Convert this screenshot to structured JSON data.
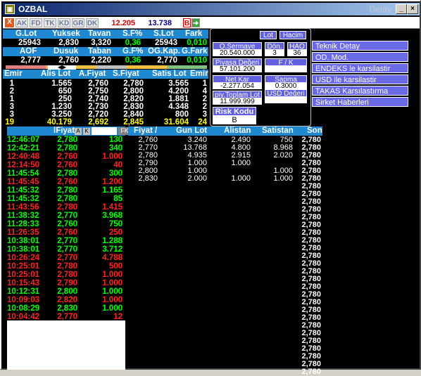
{
  "window": {
    "title": "OZBAL",
    "detail_label": "Detay"
  },
  "toolbar": {
    "close": "X",
    "tabs": [
      "AK",
      "FD",
      "TK",
      "KD",
      "GR",
      "DK"
    ],
    "value1": "12.205",
    "value2": "13.738",
    "b": "B"
  },
  "summary1": {
    "headers": [
      "G.Lot",
      "Yuksek",
      "Tavan",
      "S.F%",
      "S.Lot",
      "Fark"
    ],
    "values": [
      "25943",
      "2,830",
      "3,320",
      "0,36",
      "25943",
      "0,010"
    ]
  },
  "summary2": {
    "headers": [
      "AOF",
      "Dusuk",
      "Taban",
      "G.F%",
      "OG.Kap.",
      "G.Fark"
    ],
    "values": [
      "2,777",
      "2,760",
      "2,220",
      "0,36",
      "2,770",
      "0,010"
    ]
  },
  "book": {
    "headers": [
      "Emir",
      "Alis Lot",
      "A.Fiyat",
      "S.Fiyat",
      "Satis Lot",
      "Emir"
    ],
    "rows": [
      [
        "1",
        "1.565",
        "2,760",
        "2,780",
        "3.565",
        "1"
      ],
      [
        "2",
        "650",
        "2,750",
        "2,800",
        "4.200",
        "4"
      ],
      [
        "1",
        "250",
        "2,740",
        "2,820",
        "1.881",
        "2"
      ],
      [
        "3",
        "1.230",
        "2,730",
        "2,830",
        "4.348",
        "2"
      ],
      [
        "3",
        "3.250",
        "2,720",
        "2,840",
        "800",
        "3"
      ],
      [
        "19",
        "40.179",
        "2,692",
        "2,845",
        "31.604",
        "24"
      ]
    ]
  },
  "info": {
    "lot": "Lot",
    "hacim": "Hacim",
    "osermaye": "O.Sermaye",
    "osermaye_val": "20.540.000",
    "don": "Dön.",
    "don_val": "3",
    "hao": "HAO",
    "hao_val": "36",
    "piyasa": "Piyasa Değeri",
    "piyasa_val": "57.101.200",
    "fk": "F / K",
    "netkar": "Net Kar",
    "netkar_val": "-2.277.054",
    "sapma": "Sapma",
    "sapma_val": "0.3000",
    "toplamlot": "piy.Toplam Lot",
    "toplamlot_val": "11.999.999",
    "usd": "USD Değeri",
    "risk": "Risk Kodu",
    "risk_val": "B"
  },
  "menu": [
    "Teknik Detay",
    "OD. Mod.",
    "ENDEKS le karsilastir",
    "USD ile karsilastir",
    "TAKAS Karsılastırma",
    "Sirket Haberleri"
  ],
  "trades": {
    "header_fiyat": "lFiyat",
    "a": "A",
    "k": "K",
    "fk": "FK",
    "rows": [
      [
        "12:46:07",
        "2,780",
        "130",
        "g"
      ],
      [
        "12:42:21",
        "2,780",
        "340",
        "g"
      ],
      [
        "12:40:48",
        "2,760",
        "1.000",
        "r"
      ],
      [
        "12:14:50",
        "2,760",
        "40",
        "r"
      ],
      [
        "11:45:54",
        "2,780",
        "300",
        "g"
      ],
      [
        "11:45:45",
        "2,760",
        "1.200",
        "r"
      ],
      [
        "11:45:32",
        "2,780",
        "1.165",
        "g"
      ],
      [
        "11:45:32",
        "2,780",
        "85",
        "g"
      ],
      [
        "11:43:56",
        "2,780",
        "1.415",
        "r"
      ],
      [
        "11:38:32",
        "2,770",
        "3.968",
        "g"
      ],
      [
        "11:28:33",
        "2,760",
        "750",
        "g"
      ],
      [
        "11:26:35",
        "2,760",
        "250",
        "r"
      ],
      [
        "10:38:01",
        "2,770",
        "1.288",
        "g"
      ],
      [
        "10:38:01",
        "2,770",
        "3.712",
        "g"
      ],
      [
        "10:26:24",
        "2,770",
        "4.788",
        "r"
      ],
      [
        "10:25:01",
        "2,780",
        "500",
        "r"
      ],
      [
        "10:25:01",
        "2,780",
        "1.000",
        "r"
      ],
      [
        "10:15:43",
        "2,790",
        "1.000",
        "r"
      ],
      [
        "10:12:31",
        "2,800",
        "1.000",
        "g"
      ],
      [
        "10:09:03",
        "2,820",
        "1.000",
        "r"
      ],
      [
        "10:08:29",
        "2,830",
        "1.000",
        "g"
      ],
      [
        "10:04:42",
        "2,770",
        "12",
        "r"
      ]
    ]
  },
  "depth": {
    "headers": [
      "Fiyat /",
      "Gun Lot",
      "Alistan",
      "Satistan",
      "Son"
    ],
    "rows": [
      [
        "2,760",
        "3.240",
        "2.490",
        "750"
      ],
      [
        "2,770",
        "13.768",
        "4.800",
        "8.968"
      ],
      [
        "2,780",
        "4.935",
        "2.915",
        "2.020"
      ],
      [
        "2,790",
        "1.000",
        "1.000",
        ""
      ],
      [
        "2,800",
        "1.000",
        "",
        "1.000"
      ],
      [
        "2,830",
        "2.000",
        "1.000",
        "1.000"
      ]
    ],
    "son": "2,780",
    "son_count": 31
  }
}
